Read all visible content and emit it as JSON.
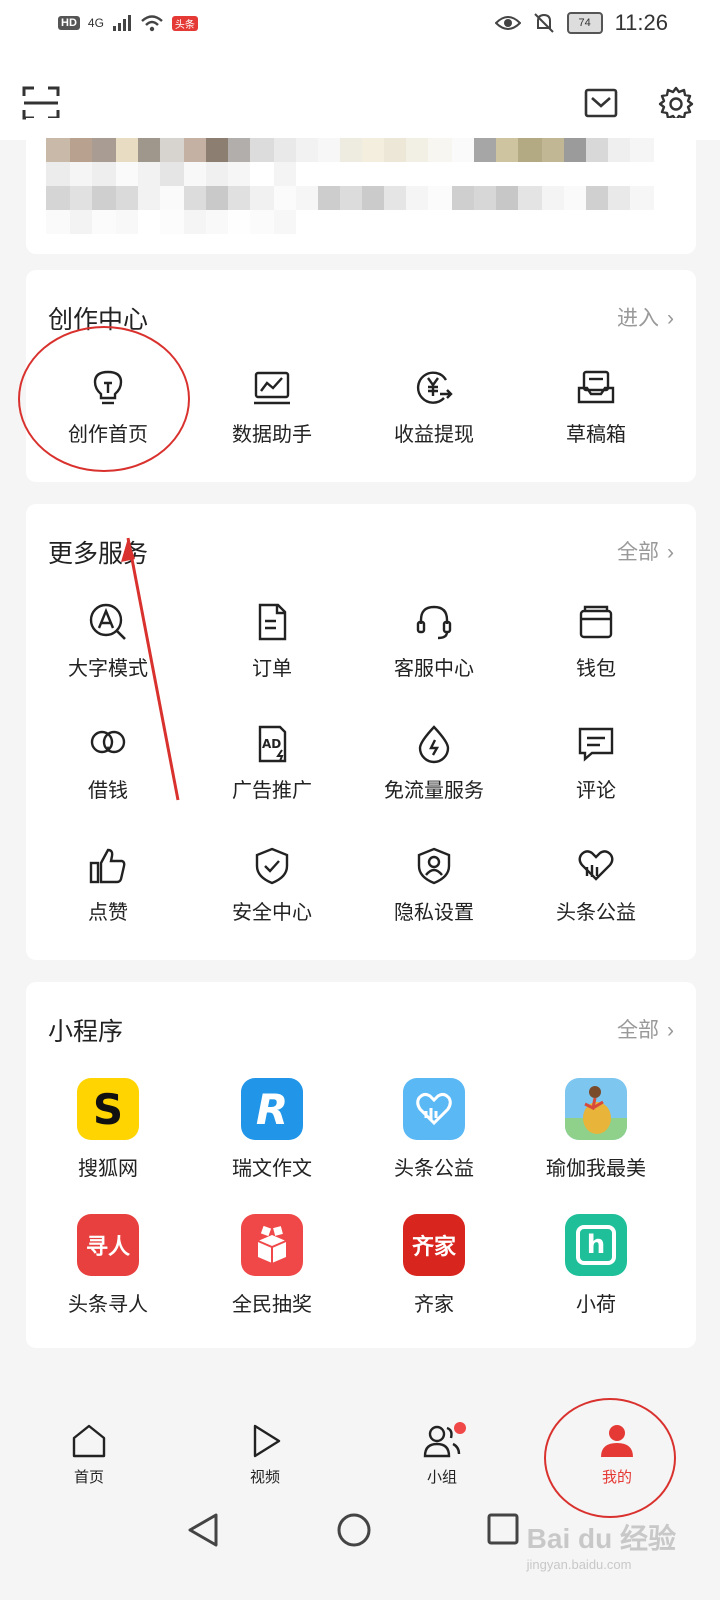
{
  "status_bar": {
    "hd": "HD",
    "network": "4G",
    "app_badge": "头条",
    "battery": "74",
    "time": "11:26"
  },
  "header": {
    "scan_icon": "scan-icon",
    "mail_icon": "mail-icon",
    "settings_icon": "gear-icon"
  },
  "creation_center": {
    "title": "创作中心",
    "more": "进入",
    "items": [
      {
        "label": "创作首页",
        "icon": "lightbulb-icon"
      },
      {
        "label": "数据助手",
        "icon": "chart-icon"
      },
      {
        "label": "收益提现",
        "icon": "yuan-withdraw-icon"
      },
      {
        "label": "草稿箱",
        "icon": "drafts-icon"
      }
    ]
  },
  "more_services": {
    "title": "更多服务",
    "more": "全部",
    "items": [
      {
        "label": "大字模式",
        "icon": "large-font-icon"
      },
      {
        "label": "订单",
        "icon": "order-icon"
      },
      {
        "label": "客服中心",
        "icon": "headset-icon"
      },
      {
        "label": "钱包",
        "icon": "wallet-icon"
      },
      {
        "label": "借钱",
        "icon": "loan-icon"
      },
      {
        "label": "广告推广",
        "icon": "ad-icon"
      },
      {
        "label": "免流量服务",
        "icon": "data-free-icon"
      },
      {
        "label": "评论",
        "icon": "comment-icon"
      },
      {
        "label": "点赞",
        "icon": "thumbs-up-icon"
      },
      {
        "label": "安全中心",
        "icon": "shield-check-icon"
      },
      {
        "label": "隐私设置",
        "icon": "privacy-icon"
      },
      {
        "label": "头条公益",
        "icon": "charity-icon"
      }
    ]
  },
  "mini_programs": {
    "title": "小程序",
    "more": "全部",
    "items": [
      {
        "label": "搜狐网",
        "icon": "sohu-app-icon",
        "tile_text": "S",
        "color": "#ffd400"
      },
      {
        "label": "瑞文作文",
        "icon": "ruiwen-app-icon",
        "tile_text": "R",
        "color": "#2196e8"
      },
      {
        "label": "头条公益",
        "icon": "toutiao-charity-app-icon",
        "tile_text": "",
        "color": "#5ab8f5"
      },
      {
        "label": "瑜伽我最美",
        "icon": "yoga-app-icon",
        "tile_text": "",
        "color": "#7cc6f0"
      },
      {
        "label": "头条寻人",
        "icon": "find-person-app-icon",
        "tile_text": "寻人",
        "color": "#e8403e"
      },
      {
        "label": "全民抽奖",
        "icon": "lottery-app-icon",
        "tile_text": "",
        "color": "#f04848"
      },
      {
        "label": "齐家",
        "icon": "qijia-app-icon",
        "tile_text": "齐家",
        "color": "#d8261f"
      },
      {
        "label": "小荷",
        "icon": "xiaohe-app-icon",
        "tile_text": "h",
        "color": "#1fbf9a"
      }
    ]
  },
  "tabs": [
    {
      "label": "首页",
      "icon": "home-icon"
    },
    {
      "label": "视频",
      "icon": "play-icon"
    },
    {
      "label": "小组",
      "icon": "group-icon"
    },
    {
      "label": "我的",
      "icon": "user-icon"
    }
  ],
  "watermark": {
    "main": "Bai du 经验",
    "sub": "jingyan.baidu.com"
  },
  "colors": {
    "accent": "#e53935",
    "annotation": "#d9322e"
  }
}
